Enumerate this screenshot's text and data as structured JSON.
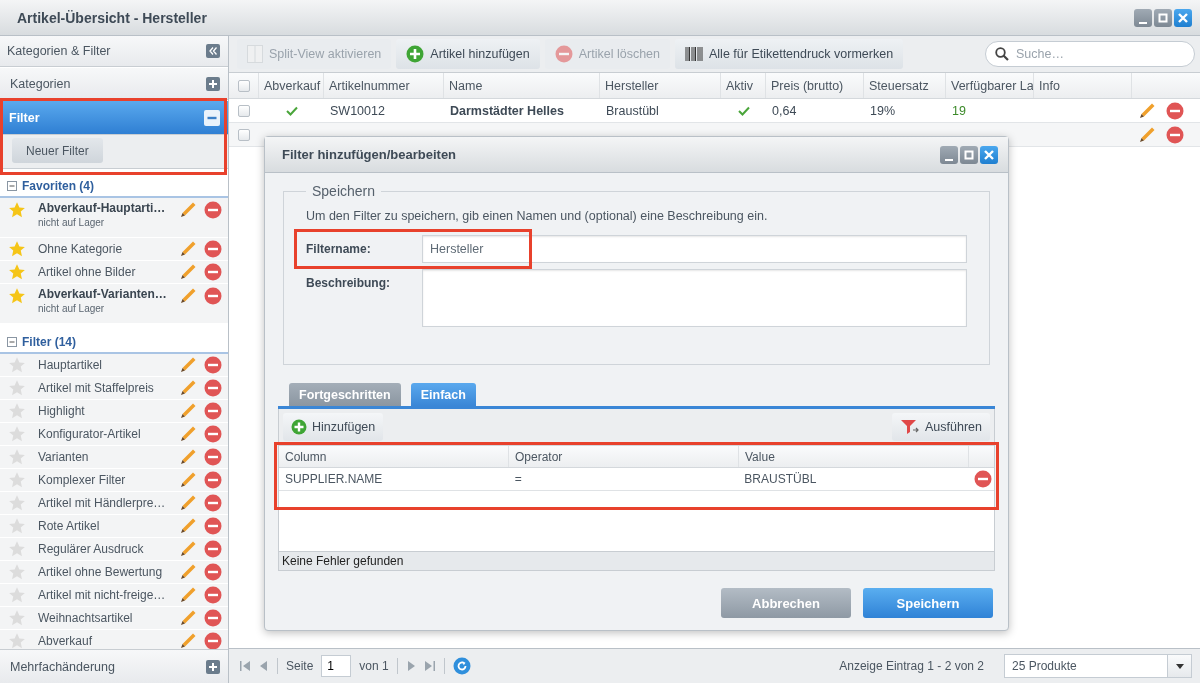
{
  "window": {
    "title": "Artikel-Übersicht - Hersteller"
  },
  "sidebar": {
    "title": "Kategorien & Filter",
    "categories": {
      "label": "Kategorien",
      "expanded": false
    },
    "filter": {
      "label": "Filter",
      "expanded": true,
      "highlighted": true,
      "new_button": "Neuer Filter"
    },
    "groups": [
      {
        "label": "Favoriten (4)",
        "expanded": true,
        "items": [
          {
            "label": "Abverkauf-Hauptarti…",
            "subtitle": "nicht auf Lager",
            "favorite": true
          },
          {
            "label": "Ohne Kategorie",
            "favorite": true
          },
          {
            "label": "Artikel ohne Bilder",
            "favorite": true
          },
          {
            "label": "Abverkauf-Varianten…",
            "subtitle": "nicht auf Lager",
            "favorite": true
          }
        ]
      },
      {
        "label": "Filter (14)",
        "expanded": true,
        "items": [
          {
            "label": "Hauptartikel",
            "favorite": false
          },
          {
            "label": "Artikel mit Staffelpreis",
            "favorite": false
          },
          {
            "label": "Highlight",
            "favorite": false
          },
          {
            "label": "Konfigurator-Artikel",
            "favorite": false
          },
          {
            "label": "Varianten",
            "favorite": false
          },
          {
            "label": "Komplexer Filter",
            "favorite": false
          },
          {
            "label": "Artikel mit Händlerpre…",
            "favorite": false
          },
          {
            "label": "Rote Artikel",
            "favorite": false
          },
          {
            "label": "Regulärer Ausdruck",
            "favorite": false
          },
          {
            "label": "Artikel ohne Bewertung",
            "favorite": false
          },
          {
            "label": "Artikel mit nicht-freige…",
            "favorite": false
          },
          {
            "label": "Weihnachtsartikel",
            "favorite": false
          },
          {
            "label": "Abverkauf",
            "favorite": false
          }
        ]
      }
    ],
    "footer": {
      "label": "Mehrfachänderung",
      "expanded": false
    }
  },
  "toolbar": {
    "buttons": [
      {
        "label": "Split-View aktivieren",
        "kind": "split",
        "disabled": true
      },
      {
        "label": "Artikel hinzufügen",
        "kind": "add",
        "disabled": false
      },
      {
        "label": "Artikel löschen",
        "kind": "delete",
        "disabled": true
      },
      {
        "label": "Alle für Etikettendruck vormerken",
        "kind": "barcode",
        "disabled": false
      }
    ],
    "search": {
      "placeholder": "Suche…"
    }
  },
  "grid": {
    "all_selected": false,
    "columns": [
      "Abverkauf",
      "Artikelnummer",
      "Name",
      "Hersteller",
      "Aktiv",
      "Preis (brutto)",
      "Steuersatz",
      "Verfügbarer La",
      "Info"
    ],
    "rows": [
      {
        "selected": false,
        "abverkauf": true,
        "number": "SW10012",
        "name": "Darmstädter Helles",
        "manufacturer": "Braustübl",
        "active": true,
        "price": "0,64",
        "tax": "19%",
        "stock": "19"
      },
      {
        "selected": false
      }
    ]
  },
  "paging": {
    "page_label": "Seite",
    "page": "1",
    "of": "von 1",
    "summary": "Anzeige Eintrag 1 - 2 von 2",
    "page_size": "25 Produkte"
  },
  "dialog": {
    "title": "Filter hinzufügen/bearbeiten",
    "fieldset": "Speichern",
    "hint": "Um den Filter zu speichern, gib einen Namen und (optional) eine Beschreibung ein.",
    "name_label": "Filtername:",
    "name_value": "Hersteller",
    "name_highlighted": true,
    "description_label": "Beschreibung:",
    "tabs": [
      {
        "label": "Fortgeschritten",
        "selected": false
      },
      {
        "label": "Einfach",
        "selected": true
      }
    ],
    "add_button": "Hinzufügen",
    "run_button": "Ausführen",
    "conditions": {
      "highlighted": true,
      "columns": [
        "Column",
        "Operator",
        "Value"
      ],
      "rows": [
        {
          "column": "SUPPLIER.NAME",
          "operator": "=",
          "value": "BRAUSTÜBL"
        }
      ]
    },
    "status": "Keine Fehler gefunden",
    "buttons": [
      {
        "label": "Abbrechen",
        "kind": "cancel"
      },
      {
        "label": "Speichern",
        "kind": "save"
      }
    ]
  }
}
